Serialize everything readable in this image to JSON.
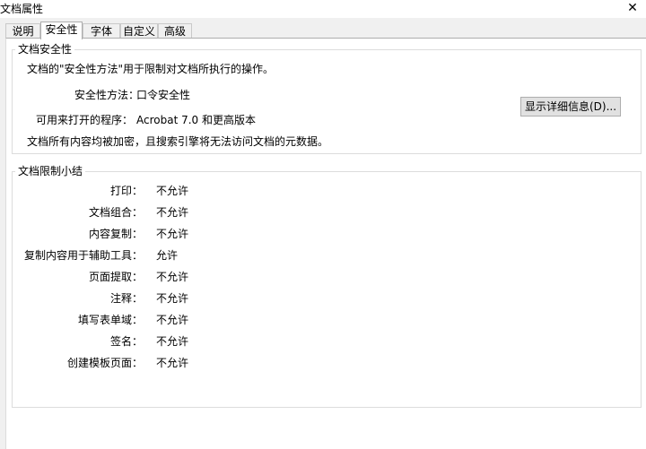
{
  "window": {
    "title": "文档属性",
    "close_glyph": "✕"
  },
  "tabs": [
    {
      "label": "说明"
    },
    {
      "label": "安全性",
      "active": true
    },
    {
      "label": "字体"
    },
    {
      "label": "自定义"
    },
    {
      "label": "高级"
    }
  ],
  "security": {
    "group_title": "文档安全性",
    "description": "文档的\"安全性方法\"用于限制对文档所执行的操作。",
    "method_label": "安全性方法：",
    "method_value": "口令安全性",
    "details_button": "显示详细信息(D)...",
    "openable_label": "可用来打开的程序：",
    "openable_value": "Acrobat 7.0 和更高版本",
    "encryption_note": "文档所有内容均被加密，且搜索引擎将无法访问文档的元数据。"
  },
  "restrictions": {
    "group_title": "文档限制小结",
    "items": [
      {
        "label": "打印：",
        "value": "不允许"
      },
      {
        "label": "文档组合：",
        "value": "不允许"
      },
      {
        "label": "内容复制：",
        "value": "不允许"
      },
      {
        "label": "复制内容用于辅助工具：",
        "value": "允许"
      },
      {
        "label": "页面提取：",
        "value": "不允许"
      },
      {
        "label": "注释：",
        "value": "不允许"
      },
      {
        "label": "填写表单域：",
        "value": "不允许"
      },
      {
        "label": "签名：",
        "value": "不允许"
      },
      {
        "label": "创建模板页面：",
        "value": "不允许"
      }
    ]
  }
}
